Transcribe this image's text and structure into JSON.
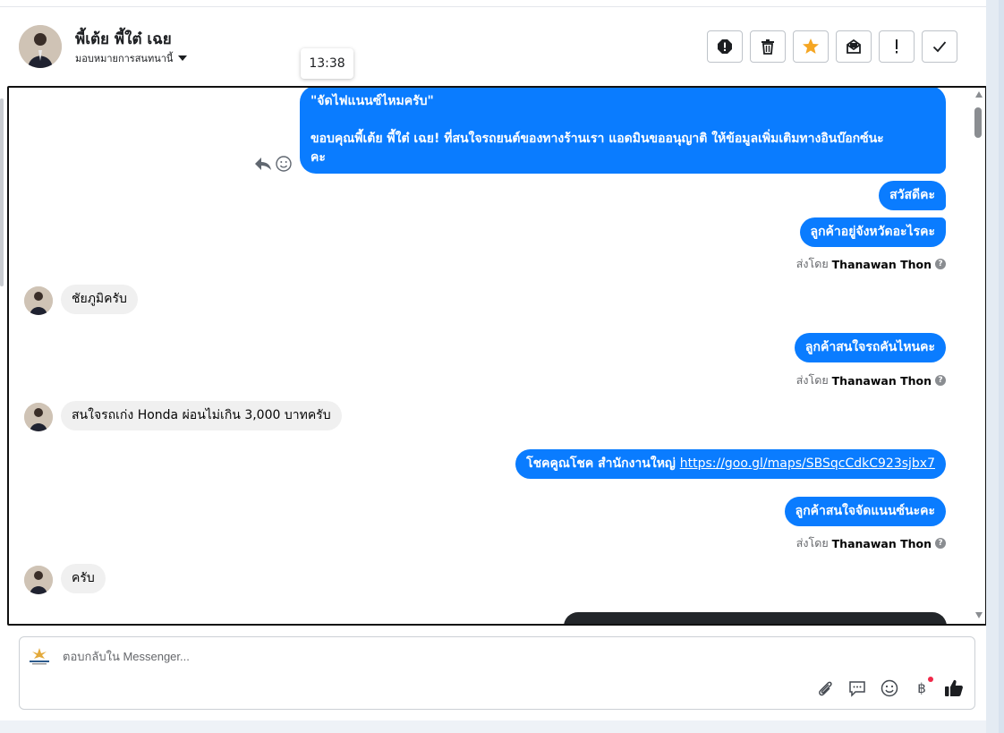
{
  "header": {
    "contact_name": "พี้เต้ย พี้ใต๋ เฉย",
    "assign_label": "มอบหมายการสนทนานี้",
    "actions": [
      {
        "name": "spam-alert-button",
        "icon": "exclamation-circle-icon"
      },
      {
        "name": "delete-button",
        "icon": "trash-icon"
      },
      {
        "name": "star-button",
        "icon": "star-icon"
      },
      {
        "name": "mark-unread-button",
        "icon": "mail-open-icon"
      },
      {
        "name": "follow-up-button",
        "icon": "exclamation-icon"
      },
      {
        "name": "mark-done-button",
        "icon": "check-icon"
      }
    ],
    "star_color": "#f5a623"
  },
  "tooltip": {
    "time": "13:38"
  },
  "conversation": {
    "msg1": {
      "line1": "\"จัดไฟแนนซ์ไหมครับ\"",
      "line2": "ขอบคุณพี้เต้ย พี้ใต๋ เฉย! ที่สนใจรถยนต์ของทางร้านเรา แอดมินขออนุญาติ ให้ข้อมูลเพิ่มเติมทางอินบ๊อกซ์นะ",
      "line3": "คะ"
    },
    "msg2": "สวัสดีคะ",
    "msg3": "ลูกค้าอยู่จังหวัดอะไรคะ",
    "sentby_prefix": "ส่งโดย",
    "sentby_agent": "Thanawan Thon",
    "in1": "ชัยภูมิครับ",
    "msg4": "ลูกค้าสนใจรถคันไหนคะ",
    "in2": "สนใจรถเก่ง Honda ผ่อนไม่เกิน 3,000 บาทครับ",
    "msg5_text": "โชคคูณโชค สำนักงานใหญ่ ",
    "msg5_link": "https://goo.gl/maps/SBSqcCdkC923sjbx7",
    "msg6": "ลูกค้าสนใจจัดแนนซ์นะคะ",
    "in3": "ครับ"
  },
  "composer": {
    "placeholder": "ตอบกลับใน Messenger...",
    "tools": [
      "paperclip-icon",
      "saved-reply-icon",
      "emoji-icon",
      "baht-icon",
      "thumbs-up-icon"
    ],
    "baht_symbol": "฿"
  },
  "colors": {
    "outgoing_bubble": "#0a7cff",
    "incoming_bubble": "#f0f0f0",
    "accent_dark": "#1c1e21"
  }
}
